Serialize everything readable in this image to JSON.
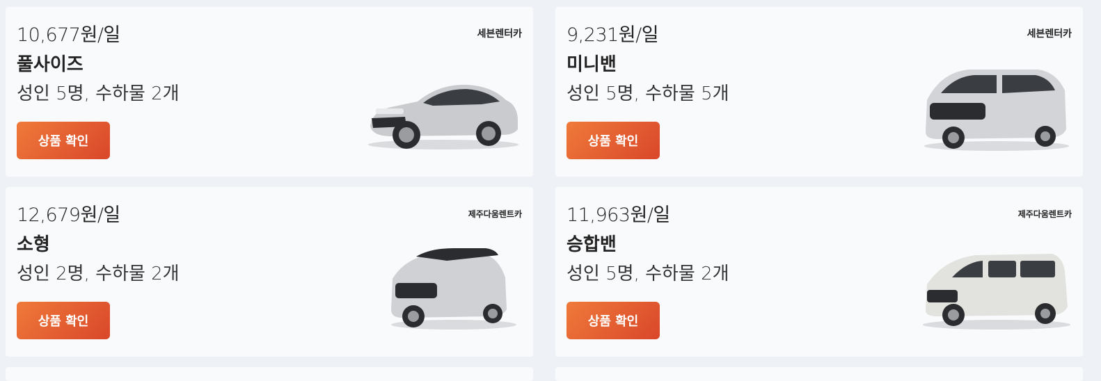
{
  "cards": [
    {
      "price": "10,677원/일",
      "name": "풀사이즈",
      "spec": "성인 5명, 수하물 2개",
      "vendor": "세븐렌터카",
      "button": "상품 확인",
      "car_icon": "sedan-car"
    },
    {
      "price": "9,231원/일",
      "name": "미니밴",
      "spec": "성인 5명, 수하물 5개",
      "vendor": "세븐렌터카",
      "button": "상품 확인",
      "car_icon": "minivan-car"
    },
    {
      "price": "12,679원/일",
      "name": "소형",
      "spec": "성인 2명, 수하물 2개",
      "vendor": "제주다움렌트카",
      "button": "상품 확인",
      "car_icon": "compact-car"
    },
    {
      "price": "11,963원/일",
      "name": "승합밴",
      "spec": "성인 5명, 수하물 2개",
      "vendor": "제주다움렌트카",
      "button": "상품 확인",
      "car_icon": "van-car"
    }
  ],
  "colors": {
    "button_start": "#ef7a3a",
    "button_end": "#d9472a",
    "card_bg": "#f9fafc",
    "page_bg": "#eef1f5"
  }
}
